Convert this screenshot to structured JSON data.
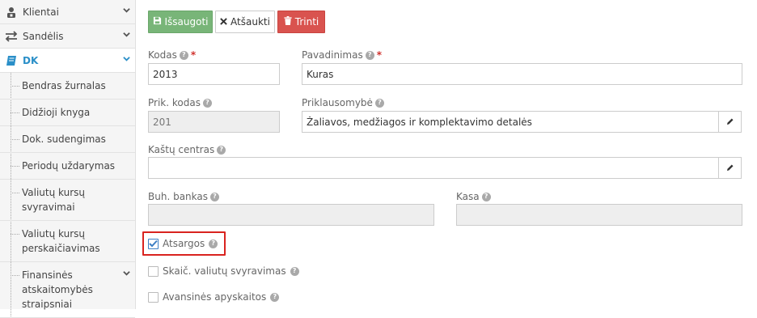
{
  "sidebar": {
    "items": [
      {
        "label": "Klientai",
        "icon": "user-lock-icon"
      },
      {
        "label": "Sandėlis",
        "icon": "exchange-icon"
      },
      {
        "label": "DK",
        "icon": "book-icon"
      }
    ],
    "dk_subitems": [
      "Bendras žurnalas",
      "Didžioji knyga",
      "Dok. sudengimas",
      "Periodų uždarymas",
      "Valiutų kursų svyravimai",
      "Valiutų kursų perskaičiavimas",
      "Finansinės atskaitomybės straipsniai"
    ]
  },
  "toolbar": {
    "save_label": "Išsaugoti",
    "cancel_label": "Atšaukti",
    "delete_label": "Trinti"
  },
  "form": {
    "kodas": {
      "label": "Kodas",
      "value": "2013"
    },
    "pavadinimas": {
      "label": "Pavadinimas",
      "value": "Kuras"
    },
    "prik_kodas": {
      "label": "Prik. kodas",
      "value": "201"
    },
    "priklausomybe": {
      "label": "Priklausomybė",
      "value": "Žaliavos, medžiagos ir komplektavimo detalės"
    },
    "kastu_centras": {
      "label": "Kaštų centras",
      "value": ""
    },
    "buh_bankas": {
      "label": "Buh. bankas",
      "value": ""
    },
    "kasa": {
      "label": "Kasa",
      "value": ""
    },
    "atsargos": {
      "label": "Atsargos",
      "checked": true
    },
    "skaic_valiutu": {
      "label": "Skaič. valiutų svyravimas",
      "checked": false
    },
    "avansines": {
      "label": "Avansinės apyskaitos",
      "checked": false
    }
  },
  "colors": {
    "accent": "#2a8fc8",
    "save": "#78b578",
    "delete": "#d9534f",
    "highlight": "#d9231f"
  }
}
